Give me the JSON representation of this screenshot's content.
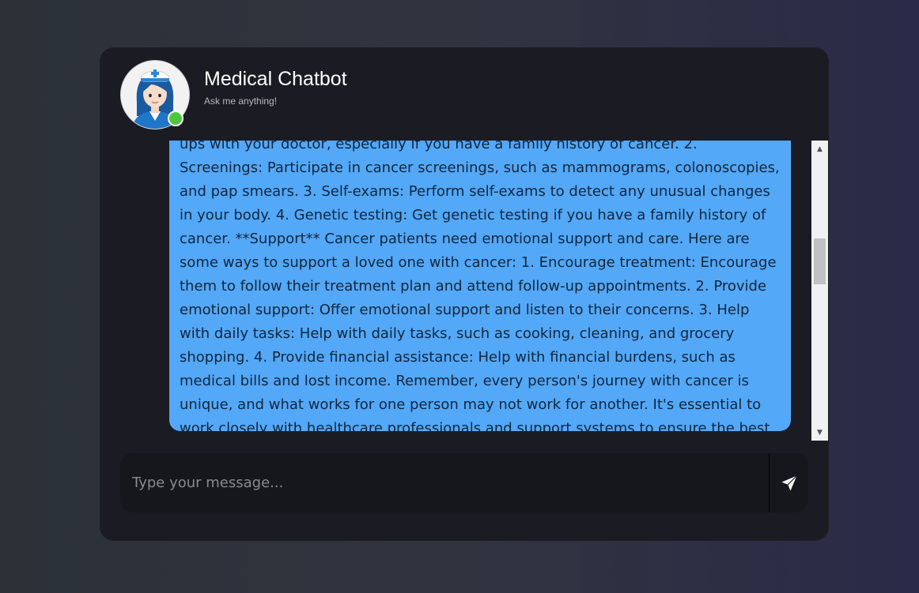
{
  "header": {
    "title": "Medical Chatbot",
    "subtitle": "Ask me anything!",
    "avatar_icon": "nurse-avatar",
    "status": "online",
    "status_color": "#4cc83a"
  },
  "messages": [
    {
      "sender": "bot",
      "text": "ups with your doctor, especially if you have a family history of cancer. 2. Screenings: Participate in cancer screenings, such as mammograms, colonoscopies, and pap smears. 3. Self-exams: Perform self-exams to detect any unusual changes in your body. 4. Genetic testing: Get genetic testing if you have a family history of cancer. **Support** Cancer patients need emotional support and care. Here are some ways to support a loved one with cancer: 1. Encourage treatment: Encourage them to follow their treatment plan and attend follow-up appointments. 2. Provide emotional support: Offer emotional support and listen to their concerns. 3. Help with daily tasks: Help with daily tasks, such as cooking, cleaning, and grocery shopping. 4. Provide financial assistance: Help with financial burdens, such as medical bills and lost income. Remember, every person's journey with cancer is unique, and what works for one person may not work for another. It's essential to work closely with healthcare professionals and support systems to ensure the best possible outcome.",
      "bubble_color": "#53a8f8"
    }
  ],
  "input": {
    "placeholder": "Type your message...",
    "value": ""
  },
  "send_button": {
    "icon": "send-icon"
  },
  "scroll": {
    "position_fraction": 0.37
  }
}
